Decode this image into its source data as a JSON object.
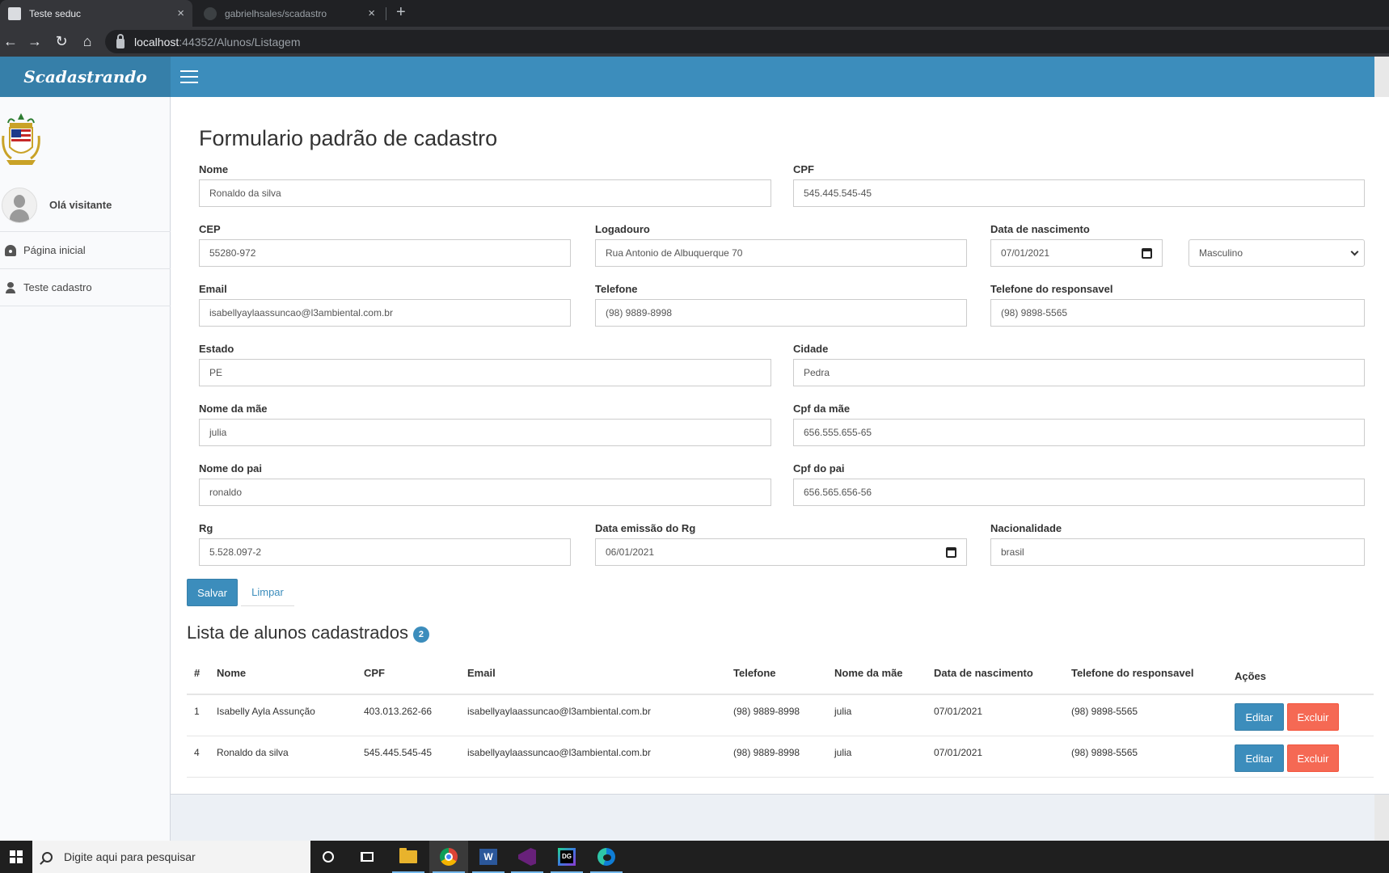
{
  "browser": {
    "tabs": [
      {
        "title": "Teste seduc",
        "icon": "document-icon"
      },
      {
        "title": "gabrielhsales/scadastro",
        "icon": "github-icon"
      }
    ],
    "url_host": "localhost",
    "url_rest": ":44352/Alunos/Listagem",
    "new_tab_label": "+",
    "close_label": "×"
  },
  "app": {
    "brand": "Scadastrando",
    "header_color": "#3c8dbc",
    "brand_color": "#367fa9"
  },
  "sidebar": {
    "greeting": "Olá visitante",
    "items": [
      {
        "label": "Página inicial",
        "icon": "dashboard-icon"
      },
      {
        "label": "Teste cadastro",
        "icon": "user-icon"
      }
    ]
  },
  "form": {
    "title": "Formulario padrão de cadastro",
    "nome": {
      "label": "Nome",
      "value": "Ronaldo da silva"
    },
    "cpf": {
      "label": "CPF",
      "value": "545.445.545-45"
    },
    "cep": {
      "label": "CEP",
      "value": "55280-972"
    },
    "logradouro": {
      "label": "Logadouro",
      "value": "Rua Antonio de Albuquerque 70"
    },
    "nascimento": {
      "label": "Data de nascimento",
      "value": "07/01/2021"
    },
    "sexo": {
      "value": "Masculino"
    },
    "email": {
      "label": "Email",
      "value": "isabellyaylaassuncao@l3ambiental.com.br"
    },
    "telefone": {
      "label": "Telefone",
      "value": "(98) 9889-8998"
    },
    "telefone_resp": {
      "label": "Telefone do responsavel",
      "value": "(98) 9898-5565"
    },
    "estado": {
      "label": "Estado",
      "value": "PE"
    },
    "cidade": {
      "label": "Cidade",
      "value": "Pedra"
    },
    "nome_mae": {
      "label": "Nome da mãe",
      "value": "julia"
    },
    "cpf_mae": {
      "label": "Cpf da mãe",
      "value": "656.555.655-65"
    },
    "nome_pai": {
      "label": "Nome do pai",
      "value": "ronaldo"
    },
    "cpf_pai": {
      "label": "Cpf do pai",
      "value": "656.565.656-56"
    },
    "rg": {
      "label": "Rg",
      "value": "5.528.097-2"
    },
    "rg_emissao": {
      "label": "Data emissão do Rg",
      "value": "06/01/2021"
    },
    "nacionalidade": {
      "label": "Nacionalidade",
      "value": "brasil"
    },
    "save_label": "Salvar",
    "clear_label": "Limpar"
  },
  "list": {
    "title": "Lista de alunos cadastrados",
    "count": "2",
    "headers": [
      "#",
      "Nome",
      "CPF",
      "Email",
      "Telefone",
      "Nome da mãe",
      "Data de nascimento",
      "Telefone do responsavel",
      "Ações"
    ],
    "rows": [
      {
        "id": "1",
        "nome": "Isabelly Ayla Assunção",
        "cpf": "403.013.262-66",
        "email": "isabellyaylaassuncao@l3ambiental.com.br",
        "telefone": "(98) 9889-8998",
        "mae": "julia",
        "nascimento": "07/01/2021",
        "tel_resp": "(98) 9898-5565"
      },
      {
        "id": "4",
        "nome": "Ronaldo da silva",
        "cpf": "545.445.545-45",
        "email": "isabellyaylaassuncao@l3ambiental.com.br",
        "telefone": "(98) 9889-8998",
        "mae": "julia",
        "nascimento": "07/01/2021",
        "tel_resp": "(98) 9898-5565"
      }
    ],
    "edit_label": "Editar",
    "delete_label": "Excluir",
    "edit_color": "#3c8dbc",
    "delete_color": "#f56954"
  },
  "taskbar": {
    "search_placeholder": "Digite aqui para pesquisar",
    "apps": [
      "cortana-icon",
      "task-view-icon",
      "file-explorer-icon",
      "chrome-icon",
      "word-icon",
      "visual-studio-icon",
      "datagrip-icon",
      "edge-icon"
    ]
  }
}
